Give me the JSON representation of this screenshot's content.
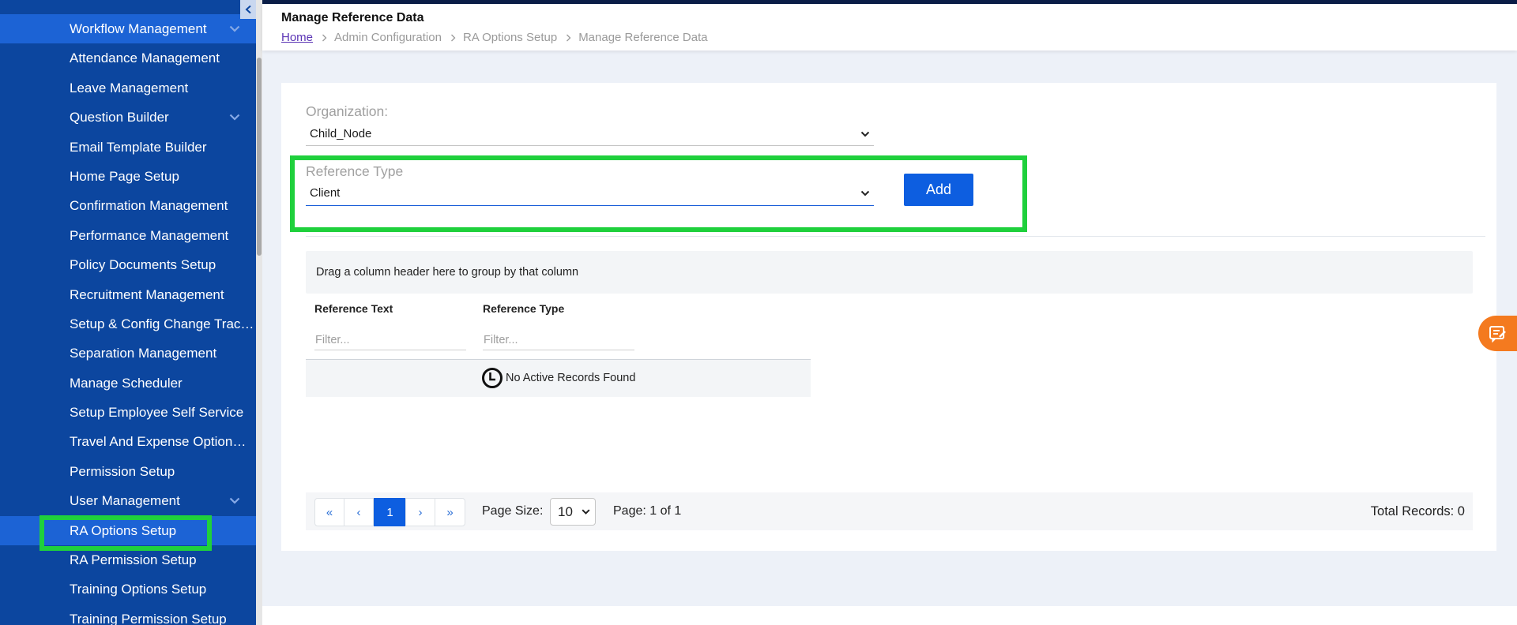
{
  "colors": {
    "sidebar_bg": "#0c469f",
    "sidebar_highlight": "#1c63d5",
    "accent": "#0d5ee0",
    "annotation_green": "#1fd03c",
    "feedback_orange": "#f47a1f",
    "page_bg": "#edf1f8"
  },
  "sidebar": {
    "collapse_icon": "chevron-left-icon",
    "submenu_icon": "chevron-down-icon",
    "items": [
      {
        "label": "Workflow Management",
        "submenu": true,
        "highlighted": true
      },
      {
        "label": "Attendance Management"
      },
      {
        "label": "Leave Management"
      },
      {
        "label": "Question Builder",
        "submenu": true
      },
      {
        "label": "Email Template Builder"
      },
      {
        "label": "Home Page Setup"
      },
      {
        "label": "Confirmation Management"
      },
      {
        "label": "Performance Management"
      },
      {
        "label": "Policy Documents Setup"
      },
      {
        "label": "Recruitment Management"
      },
      {
        "label": "Setup & Config Change Trac…"
      },
      {
        "label": "Separation Management"
      },
      {
        "label": "Manage Scheduler"
      },
      {
        "label": "Setup Employee Self Service"
      },
      {
        "label": "Travel And Expense Option…"
      },
      {
        "label": "Permission Setup"
      },
      {
        "label": "User Management",
        "submenu": true
      },
      {
        "label": "RA Options Setup",
        "active": true
      },
      {
        "label": "RA Permission Setup"
      },
      {
        "label": "Training Options Setup"
      },
      {
        "label": "Training Permission Setup"
      }
    ]
  },
  "header": {
    "title": "Manage Reference Data",
    "breadcrumb": [
      "Home",
      "Admin Configuration",
      "RA Options Setup",
      "Manage Reference Data"
    ]
  },
  "form": {
    "organization_label": "Organization:",
    "organization_value": "Child_Node",
    "reference_type_label": "Reference Type",
    "reference_type_value": "Client",
    "add_label": "Add"
  },
  "grid": {
    "group_panel_text": "Drag a column header here to group by that column",
    "columns": [
      "Reference Text",
      "Reference Type"
    ],
    "filter_placeholder": "Filter...",
    "no_records_icon": "clock-icon",
    "no_records_text": "No Active Records Found"
  },
  "pager": {
    "first": "«",
    "prev": "‹",
    "current": "1",
    "next": "›",
    "last": "»",
    "page_size_label": "Page Size:",
    "page_size": "10",
    "page_info": "Page: 1 of 1",
    "total": "Total Records: 0"
  },
  "feedback_icon": "feedback-icon"
}
